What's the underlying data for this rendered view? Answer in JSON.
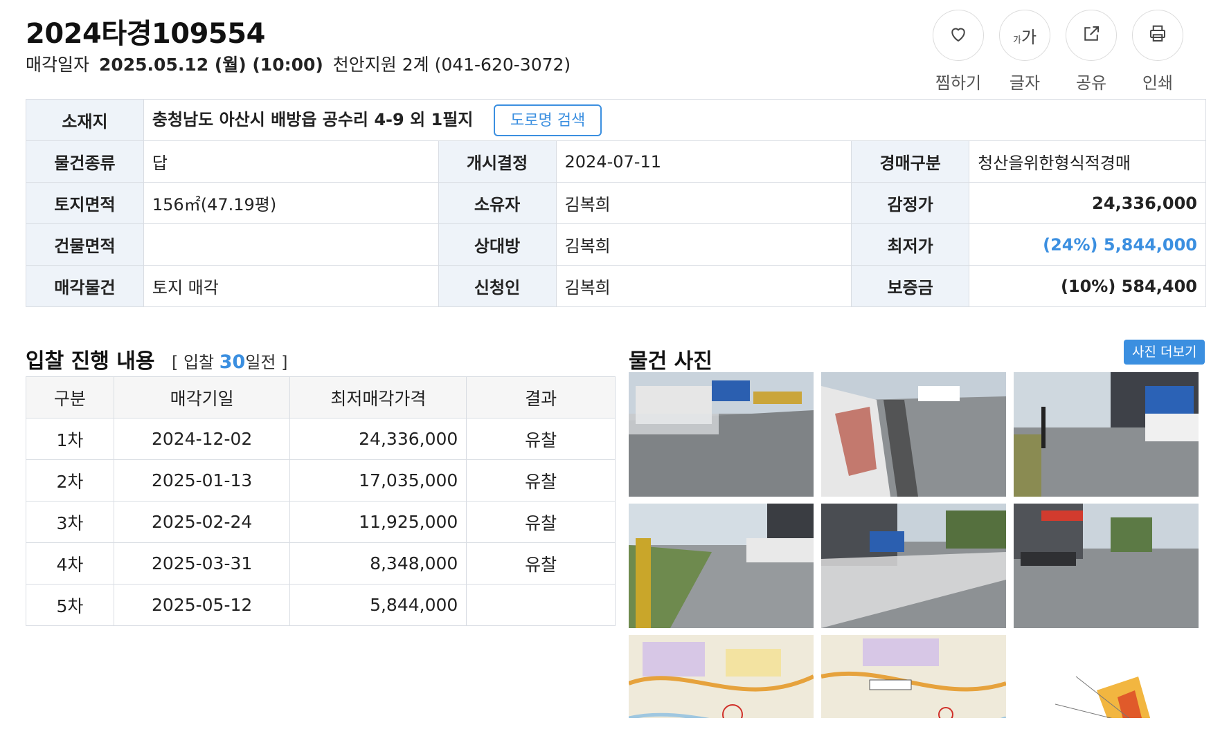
{
  "case": {
    "title": "2024타경109554",
    "sale_label": "매각일자",
    "sale_date": "2025.05.12 (월) (10:00)",
    "court": "천안지원 2계 (041-620-3072)"
  },
  "actions": [
    {
      "icon": "heart-icon",
      "label": "찜하기"
    },
    {
      "icon": "font-size-icon",
      "label": "글자",
      "glyph_small": "가",
      "glyph_big": "가"
    },
    {
      "icon": "share-icon",
      "label": "공유"
    },
    {
      "icon": "print-icon",
      "label": "인쇄"
    }
  ],
  "info": {
    "address_label": "소재지",
    "address": "충청남도 아산시 배방읍 공수리 4-9 외 1필지",
    "road_button": "도로명 검색",
    "rows": [
      {
        "l1": "물건종류",
        "v1": "답",
        "l2": "개시결정",
        "v2": "2024-07-11",
        "l3": "경매구분",
        "v3": "청산을위한형식적경매"
      },
      {
        "l1": "토지면적",
        "v1": "156㎡(47.19평)",
        "l2": "소유자",
        "v2": "김복희",
        "l3": "감정가",
        "v3": "24,336,000"
      },
      {
        "l1": "건물면적",
        "v1": "",
        "l2": "상대방",
        "v2": "김복희",
        "l3": "최저가",
        "v3": "(24%) 5,844,000"
      },
      {
        "l1": "매각물건",
        "v1": "토지 매각",
        "l2": "신청인",
        "v2": "김복희",
        "l3": "보증금",
        "v3": "(10%) 584,400"
      }
    ]
  },
  "bid": {
    "title": "입찰 진행 내용",
    "sub_prefix": "[ 입찰",
    "sub_days": "30",
    "sub_suffix": "일전 ]",
    "headers": [
      "구분",
      "매각기일",
      "최저매각가격",
      "결과"
    ],
    "rows": [
      [
        "1차",
        "2024-12-02",
        "24,336,000",
        "유찰"
      ],
      [
        "2차",
        "2025-01-13",
        "17,035,000",
        "유찰"
      ],
      [
        "3차",
        "2025-02-24",
        "11,925,000",
        "유찰"
      ],
      [
        "4차",
        "2025-03-31",
        "8,348,000",
        "유찰"
      ],
      [
        "5차",
        "2025-05-12",
        "5,844,000",
        ""
      ]
    ]
  },
  "photos": {
    "title": "물건 사진",
    "more": "사진 더보기"
  },
  "colors": {
    "accent": "#3b8fe0",
    "header_bg": "#eef3f9",
    "border": "#d9dde3"
  }
}
